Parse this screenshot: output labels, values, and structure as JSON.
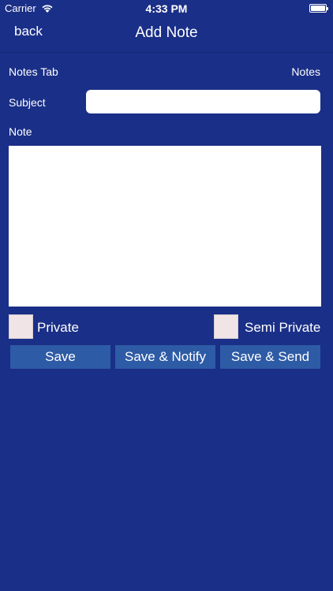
{
  "status_bar": {
    "carrier": "Carrier",
    "time": "4:33 PM",
    "wifi_icon": "wifi-icon",
    "battery_icon": "battery-icon"
  },
  "nav": {
    "back_label": "back",
    "title": "Add Note"
  },
  "form": {
    "notes_tab_label": "Notes Tab",
    "notes_tab_value": "Notes",
    "subject_label": "Subject",
    "subject_value": "",
    "note_label": "Note",
    "note_value": "",
    "private_label": "Private",
    "semi_private_label": "Semi Private"
  },
  "actions": {
    "save_label": "Save",
    "save_notify_label": "Save & Notify",
    "save_send_label": "Save & Send"
  },
  "colors": {
    "background": "#1a2f87",
    "button": "#2e5ba5",
    "checkbox": "#f0e4e6"
  }
}
